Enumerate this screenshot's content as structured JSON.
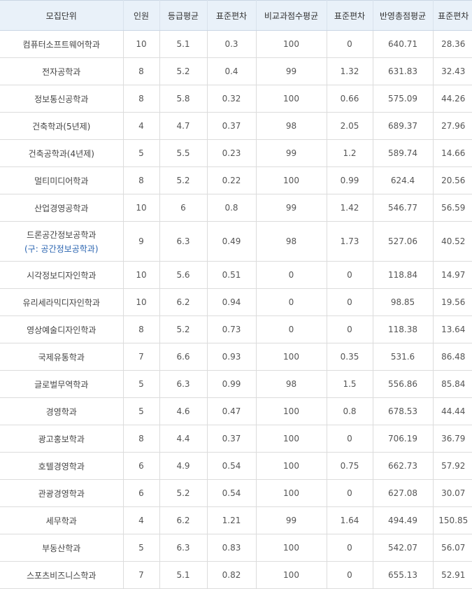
{
  "table": {
    "headers": [
      "모집단위",
      "인원",
      "등급평균",
      "표준편차",
      "비교과점수평균",
      "표준편차",
      "반영총점평균",
      "표준편차"
    ],
    "rows": [
      {
        "name": "컴퓨터소프트웨어학과",
        "cells": [
          "10",
          "5.1",
          "0.3",
          "100",
          "0",
          "640.71",
          "28.36"
        ]
      },
      {
        "name": "전자공학과",
        "cells": [
          "8",
          "5.2",
          "0.4",
          "99",
          "1.32",
          "631.83",
          "32.43"
        ]
      },
      {
        "name": "정보통신공학과",
        "cells": [
          "8",
          "5.8",
          "0.32",
          "100",
          "0.66",
          "575.09",
          "44.26"
        ]
      },
      {
        "name": "건축학과(5년제)",
        "cells": [
          "4",
          "4.7",
          "0.37",
          "98",
          "2.05",
          "689.37",
          "27.96"
        ]
      },
      {
        "name": "건축공학과(4년제)",
        "cells": [
          "5",
          "5.5",
          "0.23",
          "99",
          "1.2",
          "589.74",
          "14.66"
        ]
      },
      {
        "name": "멀티미디어학과",
        "cells": [
          "8",
          "5.2",
          "0.22",
          "100",
          "0.99",
          "624.4",
          "20.56"
        ]
      },
      {
        "name": "산업경영공학과",
        "cells": [
          "10",
          "6",
          "0.8",
          "99",
          "1.42",
          "546.77",
          "56.59"
        ]
      },
      {
        "name": "드론공간정보공학과",
        "subname": "(구: 공간정보공학과)",
        "cells": [
          "9",
          "6.3",
          "0.49",
          "98",
          "1.73",
          "527.06",
          "40.52"
        ]
      },
      {
        "name": "시각정보디자인학과",
        "cells": [
          "10",
          "5.6",
          "0.51",
          "0",
          "0",
          "118.84",
          "14.97"
        ]
      },
      {
        "name": "유리세라믹디자인학과",
        "cells": [
          "10",
          "6.2",
          "0.94",
          "0",
          "0",
          "98.85",
          "19.56"
        ]
      },
      {
        "name": "영상예술디자인학과",
        "cells": [
          "8",
          "5.2",
          "0.73",
          "0",
          "0",
          "118.38",
          "13.64"
        ]
      },
      {
        "name": "국제유통학과",
        "cells": [
          "7",
          "6.6",
          "0.93",
          "100",
          "0.35",
          "531.6",
          "86.48"
        ]
      },
      {
        "name": "글로벌무역학과",
        "cells": [
          "5",
          "6.3",
          "0.99",
          "98",
          "1.5",
          "556.86",
          "85.84"
        ]
      },
      {
        "name": "경영학과",
        "cells": [
          "5",
          "4.6",
          "0.47",
          "100",
          "0.8",
          "678.53",
          "44.44"
        ]
      },
      {
        "name": "광고홍보학과",
        "cells": [
          "8",
          "4.4",
          "0.37",
          "100",
          "0",
          "706.19",
          "36.79"
        ]
      },
      {
        "name": "호텔경영학과",
        "cells": [
          "6",
          "4.9",
          "0.54",
          "100",
          "0.75",
          "662.73",
          "57.92"
        ]
      },
      {
        "name": "관광경영학과",
        "cells": [
          "6",
          "5.2",
          "0.54",
          "100",
          "0",
          "627.08",
          "30.07"
        ]
      },
      {
        "name": "세무학과",
        "cells": [
          "4",
          "6.2",
          "1.21",
          "99",
          "1.64",
          "494.49",
          "150.85"
        ]
      },
      {
        "name": "부동산학과",
        "cells": [
          "5",
          "6.3",
          "0.83",
          "100",
          "0",
          "542.07",
          "56.07"
        ]
      },
      {
        "name": "스포츠비즈니스학과",
        "cells": [
          "7",
          "5.1",
          "0.82",
          "100",
          "0",
          "655.13",
          "52.91"
        ]
      }
    ]
  }
}
